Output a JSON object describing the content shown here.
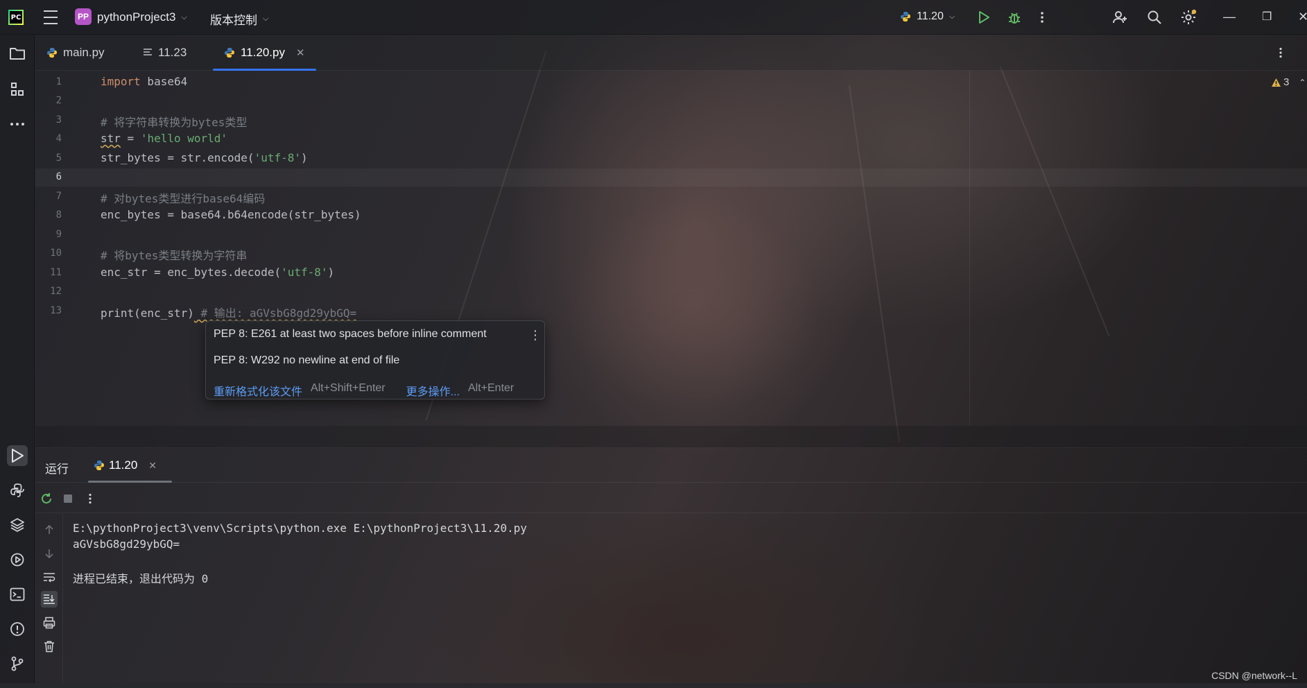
{
  "titlebar": {
    "project_badge": "PP",
    "project_name": "pythonProject3",
    "vcs_label": "版本控制",
    "run_config": "11.20"
  },
  "tabs": [
    {
      "label": "main.py",
      "icon": "python-file-icon"
    },
    {
      "label": "11.23",
      "icon": "text-file-icon"
    },
    {
      "label": "11.20.py",
      "icon": "python-file-icon",
      "active": true
    }
  ],
  "editor": {
    "warning_count": "3",
    "line_numbers": [
      "1",
      "2",
      "3",
      "4",
      "5",
      "6",
      "7",
      "8",
      "9",
      "10",
      "11",
      "12",
      "13"
    ],
    "lines": {
      "l1_kw": "import",
      "l1_rest": " base64",
      "l3": "# 将字符串转换为bytes类型",
      "l4_a": "str",
      "l4_b": " = ",
      "l4_str": "'hello world'",
      "l5_a": "str_bytes = str.encode(",
      "l5_str": "'utf-8'",
      "l5_b": ")",
      "l7": "# 对bytes类型进行base64编码",
      "l8": "enc_bytes = base64.b64encode(str_bytes)",
      "l10": "# 将bytes类型转换为字符串",
      "l11_a": "enc_str = enc_bytes.decode(",
      "l11_str": "'utf-8'",
      "l11_b": ")",
      "l13_a": "print(enc_str)",
      "l13_cmt": " # 输出: aGVsbG8gd29ybGQ="
    }
  },
  "popup": {
    "line1": "PEP 8: E261 at least two spaces before inline comment",
    "line2": "PEP 8: W292 no newline at end of file",
    "action1": "重新格式化该文件",
    "action1_key": "Alt+Shift+Enter",
    "action2": "更多操作...",
    "action2_key": "Alt+Enter"
  },
  "run_panel": {
    "title": "运行",
    "tab_label": "11.20",
    "console": [
      "E:\\pythonProject3\\venv\\Scripts\\python.exe E:\\pythonProject3\\11.20.py",
      "aGVsbG8gd29ybGQ=",
      "",
      "进程已结束，退出代码为 0"
    ]
  },
  "watermark": "CSDN @network--L",
  "colors": {
    "accent": "#3574f0",
    "run_green": "#5fb865",
    "keyword": "#cf8e6d",
    "string": "#6aab73",
    "comment": "#7a7e85",
    "link": "#5c9cf5",
    "warning": "#e0b24a"
  }
}
